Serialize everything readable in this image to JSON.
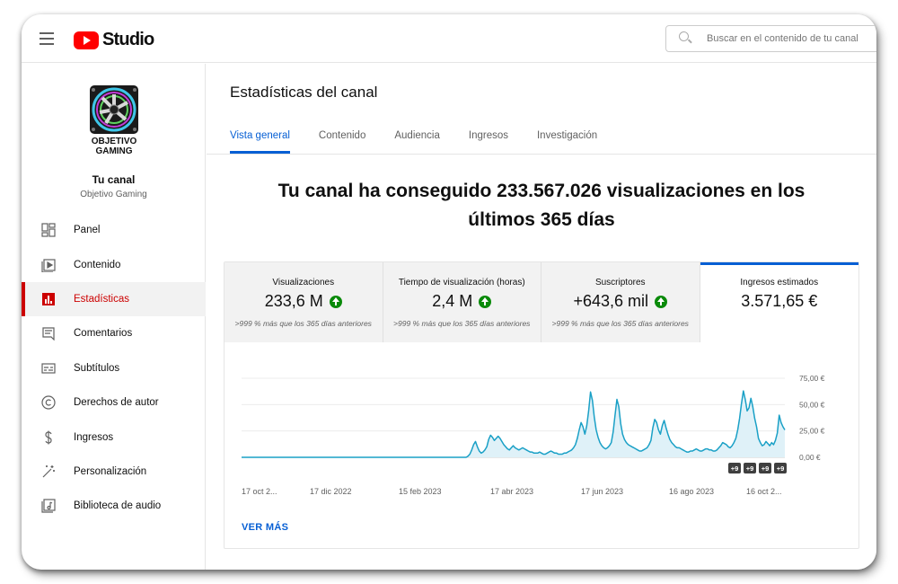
{
  "header": {
    "logo_text": "Studio",
    "search_placeholder": "Buscar en el contenido de tu canal"
  },
  "sidebar": {
    "avatar_text_line1": "OBJETIVO",
    "avatar_text_line2": "GAMING",
    "channel_label": "Tu canal",
    "channel_name": "Objetivo Gaming",
    "items": [
      {
        "label": "Panel",
        "icon": "dashboard-icon",
        "active": false
      },
      {
        "label": "Contenido",
        "icon": "content-icon",
        "active": false
      },
      {
        "label": "Estadísticas",
        "icon": "analytics-icon",
        "active": true
      },
      {
        "label": "Comentarios",
        "icon": "comments-icon",
        "active": false
      },
      {
        "label": "Subtítulos",
        "icon": "subtitles-icon",
        "active": false
      },
      {
        "label": "Derechos de autor",
        "icon": "copyright-icon",
        "active": false
      },
      {
        "label": "Ingresos",
        "icon": "dollar-icon",
        "active": false
      },
      {
        "label": "Personalización",
        "icon": "magic-wand-icon",
        "active": false
      },
      {
        "label": "Biblioteca de audio",
        "icon": "audio-library-icon",
        "active": false
      }
    ]
  },
  "main": {
    "title": "Estadísticas del canal",
    "tabs": [
      {
        "label": "Vista general",
        "active": true
      },
      {
        "label": "Contenido",
        "active": false
      },
      {
        "label": "Audiencia",
        "active": false
      },
      {
        "label": "Ingresos",
        "active": false
      },
      {
        "label": "Investigación",
        "active": false
      }
    ],
    "headline_line1": "Tu canal ha conseguido 233.567.026 visualizaciones en los",
    "headline_line2": "últimos 365 días",
    "metrics": [
      {
        "title": "Visualizaciones",
        "value": "233,6 M",
        "trend_up": true,
        "compare": ">999 % más que los 365 días anteriores"
      },
      {
        "title": "Tiempo de visualización (horas)",
        "value": "2,4 M",
        "trend_up": true,
        "compare": ">999 % más que los 365 días anteriores"
      },
      {
        "title": "Suscriptores",
        "value": "+643,6 mil",
        "trend_up": true,
        "compare": ">999 % más que los 365 días anteriores"
      },
      {
        "title": "Ingresos estimados",
        "value": "3.571,65 €",
        "trend_up": false,
        "compare": ""
      }
    ],
    "see_more": "VER MÁS"
  },
  "colors": {
    "accent_blue": "#065fd4",
    "active_red": "#cc0000",
    "line": "#1aa0c6",
    "fill": "#dff1f8",
    "trend_green": "#0a8a0a"
  },
  "chart_data": {
    "type": "area",
    "title": "",
    "xlabel": "",
    "ylabel": "",
    "ylim": [
      0,
      75
    ],
    "x_tick_labels": [
      "17 oct 2...",
      "17 dic 2022",
      "15 feb 2023",
      "17 abr 2023",
      "17 jun 2023",
      "16 ago 2023",
      "16 oct 2..."
    ],
    "y_tick_labels": [
      "0,00 €",
      "25,00 €",
      "50,00 €",
      "75,00 €"
    ],
    "y_ticks": [
      0,
      25,
      50,
      75
    ],
    "annotations": [
      "+9",
      "+9",
      "+9",
      "+9"
    ],
    "grid": true,
    "series": [
      {
        "values": [
          0,
          0,
          0,
          0,
          0,
          0,
          0,
          0,
          0,
          0,
          0,
          0,
          0,
          0,
          0,
          0,
          0,
          0,
          0,
          0,
          0,
          0,
          0,
          0,
          0,
          0,
          0,
          0,
          0,
          0,
          0,
          0,
          0,
          0,
          0,
          0,
          0,
          0,
          0,
          0,
          0,
          0,
          0,
          0,
          0,
          0,
          0,
          0,
          0,
          0,
          0,
          0,
          0,
          0,
          0,
          0,
          0,
          0,
          0,
          0,
          0,
          0,
          0,
          0,
          0,
          0,
          0,
          0,
          0,
          0,
          0,
          0,
          0,
          0,
          0,
          0,
          0,
          0,
          0,
          0,
          0,
          0,
          0,
          0,
          0,
          0,
          0,
          0,
          0,
          0,
          0,
          0,
          0,
          0,
          0,
          0,
          0,
          0,
          0,
          0,
          0,
          0,
          0,
          0,
          0,
          0,
          0,
          0,
          0,
          0,
          0,
          0,
          0,
          0,
          0,
          0,
          0,
          0,
          0,
          0,
          1,
          3,
          7,
          12,
          15,
          10,
          6,
          4,
          5,
          7,
          10,
          17,
          21,
          19,
          16,
          18,
          20,
          18,
          15,
          12,
          10,
          8,
          7,
          9,
          11,
          9,
          8,
          7,
          8,
          9,
          8,
          7,
          6,
          5,
          5,
          4,
          4,
          4,
          5,
          4,
          3,
          3,
          4,
          5,
          6,
          5,
          4,
          4,
          3,
          3,
          3,
          4,
          4,
          5,
          6,
          7,
          9,
          12,
          18,
          26,
          33,
          29,
          22,
          30,
          44,
          62,
          54,
          38,
          26,
          19,
          14,
          11,
          9,
          8,
          9,
          11,
          14,
          24,
          40,
          55,
          48,
          32,
          22,
          17,
          14,
          12,
          11,
          10,
          9,
          8,
          7,
          6,
          6,
          7,
          8,
          9,
          12,
          16,
          28,
          36,
          33,
          26,
          22,
          30,
          35,
          28,
          22,
          17,
          14,
          12,
          10,
          9,
          9,
          8,
          7,
          6,
          5,
          5,
          6,
          6,
          7,
          8,
          7,
          6,
          6,
          7,
          8,
          8,
          7,
          7,
          6,
          6,
          7,
          9,
          11,
          14,
          13,
          12,
          10,
          9,
          11,
          14,
          18,
          26,
          37,
          51,
          63,
          55,
          44,
          47,
          56,
          48,
          37,
          29,
          18,
          14,
          11,
          12,
          15,
          13,
          11,
          14,
          12,
          16,
          23,
          40,
          33,
          29,
          26
        ]
      }
    ]
  }
}
